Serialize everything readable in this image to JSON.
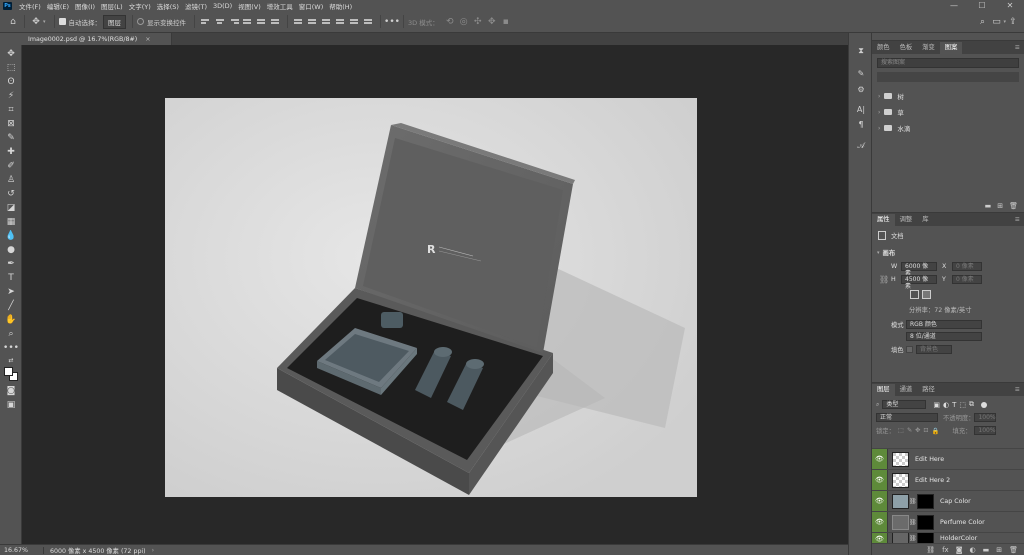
{
  "menubar": {
    "app_logo": "Ps",
    "items": [
      "文件(F)",
      "编辑(E)",
      "图像(I)",
      "图层(L)",
      "文字(Y)",
      "选择(S)",
      "滤镜(T)",
      "3D(D)",
      "视图(V)",
      "增效工具",
      "窗口(W)",
      "帮助(H)"
    ],
    "window_controls": {
      "minimize": "—",
      "maximize": "☐",
      "close": "✕"
    }
  },
  "options": {
    "auto_select_label": "自动选择：",
    "auto_select_target": "图层",
    "show_transform_label": "显示变换控件",
    "mode_3d_label": "3D 模式："
  },
  "document": {
    "tab_title": "Image0002.psd @ 16.7%(RGB/8#)",
    "tab_close": "×"
  },
  "statusbar": {
    "zoom": "16.67%",
    "info": "6000 像素 x 4500 像素 (72 ppi)",
    "arrow": "›"
  },
  "libraries_panel": {
    "tabs": [
      "颜色",
      "色板",
      "渐变",
      "图案"
    ],
    "active_tab": 3,
    "search_placeholder": "搜索图案",
    "items": [
      {
        "label": "树"
      },
      {
        "label": "草"
      },
      {
        "label": "水滴"
      }
    ]
  },
  "properties_panel": {
    "tabs": [
      "属性",
      "调整",
      "库"
    ],
    "doc_label": "文档",
    "canvas_label": "画布",
    "width_label": "W",
    "width_value": "6000 像素",
    "x_label": "X",
    "x_placeholder": "0 像素",
    "height_label": "H",
    "height_value": "4500 像素",
    "y_label": "Y",
    "y_placeholder": "0 像素",
    "resolution": "分辨率：72 像素/英寸",
    "mode_label": "模式",
    "mode_value": "RGB 颜色",
    "depth_value": "8 位/通道",
    "fill_label": "填色",
    "fill_value": "背景色"
  },
  "layers_panel": {
    "tabs": [
      "图层",
      "通道",
      "路径"
    ],
    "filter_kind": "类型",
    "blend_mode": "正常",
    "opacity_label": "不透明度：",
    "opacity_value": "100%",
    "lock_label": "锁定：",
    "fill_label": "填充：",
    "fill_value": "100%",
    "layers": [
      {
        "name": "Edit Here"
      },
      {
        "name": "Edit Here 2"
      },
      {
        "name": "Cap Color"
      },
      {
        "name": "Perfume Color"
      },
      {
        "name": "HolderColor"
      }
    ],
    "footer_icons": [
      "link-icon",
      "fx-icon",
      "mask-icon",
      "adjustment-icon",
      "group-icon",
      "new-layer-icon",
      "trash-icon"
    ]
  },
  "colors": {
    "ui_bg": "#535353",
    "canvas_bg": "#282828",
    "visibility_green": "#5e8a3a",
    "box_color": "#5a5a5a"
  }
}
